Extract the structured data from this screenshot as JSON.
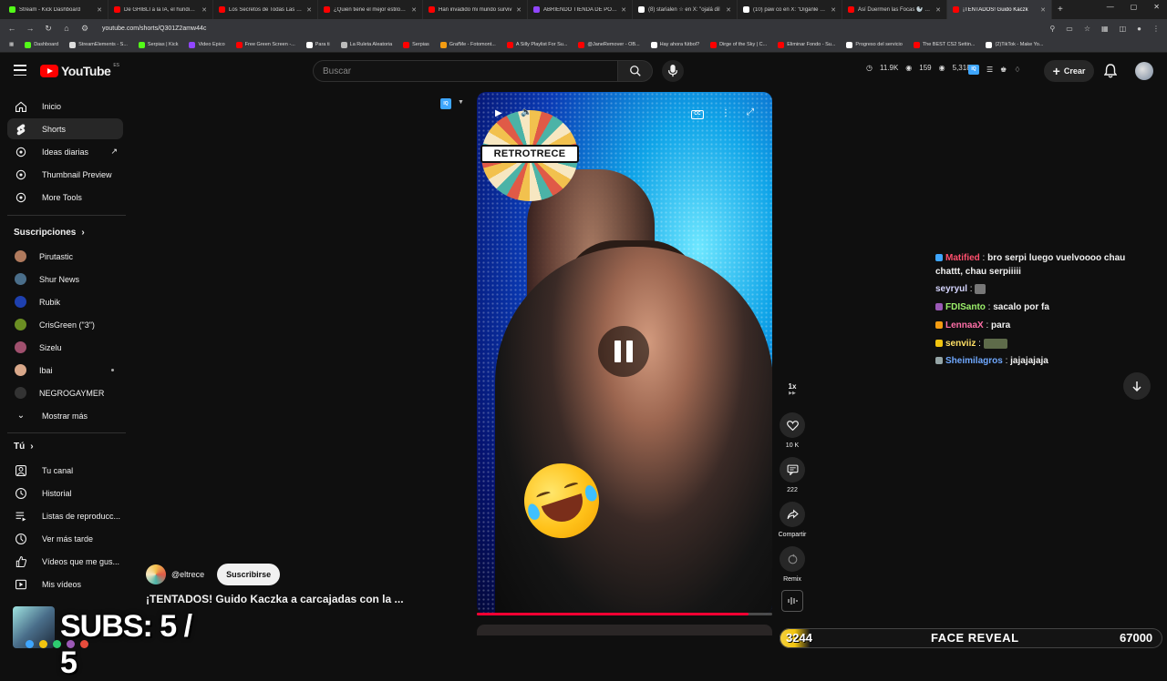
{
  "browser": {
    "tabs": [
      {
        "title": "Stream - Kick Dashboard",
        "color": "#53fc18"
      },
      {
        "title": "De GHIBLI a la IA, el hundimie",
        "color": "#ff0000"
      },
      {
        "title": "Los Secretos de Todas Las Esta",
        "color": "#ff0000"
      },
      {
        "title": "¿Quién tiene el mejor estilo? E",
        "color": "#ff0000"
      },
      {
        "title": "Han invadido mi mundo surviv",
        "color": "#ff0000"
      },
      {
        "title": "ABRIENDO TIENDA DE POKE",
        "color": "#9146ff"
      },
      {
        "title": "(8) starialen ☆ en X: \"ojalá dil",
        "color": "#ffffff"
      },
      {
        "title": "(10) paw co en X: \"Díganle a S",
        "color": "#ffffff"
      },
      {
        "title": "Así Duermen las Focas 🦭 #sh",
        "color": "#ff0000"
      },
      {
        "title": "¡TENTADOS! Guido Kaczk",
        "color": "#ff0000",
        "active": true
      }
    ],
    "url": "youtube.com/shorts/Q301Z2amw44c",
    "bookmarks": [
      {
        "label": "Dashboard",
        "color": "#53fc18"
      },
      {
        "label": "StreamElements - S...",
        "color": "#dddddd"
      },
      {
        "label": "Serpias | Kick",
        "color": "#53fc18"
      },
      {
        "label": "Video Epico",
        "color": "#9146ff"
      },
      {
        "label": "Free Green Screen -...",
        "color": "#ff0000"
      },
      {
        "label": "Para ti",
        "color": "#ffffff"
      },
      {
        "label": "La Ruleta Aleatoria",
        "color": "#bbbbbb"
      },
      {
        "label": "Serpias",
        "color": "#ff0000"
      },
      {
        "label": "GrafMe - Fotomont...",
        "color": "#f39c12"
      },
      {
        "label": "A Silly Playlist For Su...",
        "color": "#ff0000"
      },
      {
        "label": "@JaneRemover - OB...",
        "color": "#ff0000"
      },
      {
        "label": "Hay ahora fútbol?",
        "color": "#ffffff"
      },
      {
        "label": "Dirge of the Sky | C...",
        "color": "#ff0000"
      },
      {
        "label": "Eliminar Fondo - Su...",
        "color": "#ff0000"
      },
      {
        "label": "Progreso del servicio",
        "color": "#ffffff"
      },
      {
        "label": "The BEST CS2 Settin...",
        "color": "#ff0000"
      },
      {
        "label": "(2)TikTok - Make Yo...",
        "color": "#ffffff"
      }
    ]
  },
  "header": {
    "logo": "YouTube",
    "logo_country": "ES",
    "search_placeholder": "Buscar",
    "stats": {
      "views": "11.9K",
      "watching": "159",
      "eye2": "5,318"
    },
    "ext_label": "IQ",
    "create_label": "Crear"
  },
  "sidebar": {
    "main": [
      {
        "label": "Inicio",
        "icon": "home-icon"
      },
      {
        "label": "Shorts",
        "icon": "shorts-icon",
        "active": true
      },
      {
        "label": "Ideas diarias",
        "icon": "ideas-icon"
      },
      {
        "label": "Thumbnail Preview",
        "icon": "thumbnail-icon"
      },
      {
        "label": "More Tools",
        "icon": "tools-icon"
      }
    ],
    "subs_heading": "Suscripciones",
    "subscriptions": [
      {
        "label": "Pirutastic",
        "color": "#b07a5d"
      },
      {
        "label": "Shur News",
        "color": "#4a6e8a"
      },
      {
        "label": "Rubik",
        "color": "#1e40af"
      },
      {
        "label": "CrisGreen (\"3\")",
        "color": "#6b8e23"
      },
      {
        "label": "Sizelu",
        "color": "#a0506e"
      },
      {
        "label": "Ibai",
        "color": "#d9a88a",
        "new": true
      },
      {
        "label": "NEGROGAYMER",
        "color": "#333333"
      }
    ],
    "show_more": "Mostrar más",
    "you_heading": "Tú",
    "you": [
      {
        "label": "Tu canal",
        "icon": "channel-icon"
      },
      {
        "label": "Historial",
        "icon": "history-icon"
      },
      {
        "label": "Listas de reproducc...",
        "icon": "playlists-icon"
      },
      {
        "label": "Ver más tarde",
        "icon": "watch-later-icon"
      },
      {
        "label": "Vídeos que me gus...",
        "icon": "like-icon"
      },
      {
        "label": "Mis vídeos",
        "icon": "my-videos-icon"
      }
    ]
  },
  "player": {
    "overlay_logo": "RETROTRECE",
    "cc": "CC",
    "progress": 0.92
  },
  "actions": {
    "speed": "1x",
    "likes": "10 K",
    "comments": "222",
    "share": "Compartir",
    "remix": "Remix"
  },
  "channel": {
    "handle": "@eltrece",
    "subscribe": "Suscribirse",
    "title": "¡TENTADOS! Guido Kaczka a carcajadas con la ..."
  },
  "chat": [
    {
      "user": "Matified",
      "msg": "bro serpi luego vuelvoooo chau",
      "cont": "chattt, chau serpiiiii",
      "color": "#ff4f6d",
      "badge": "#3ea6ff"
    },
    {
      "user": "seyryul",
      "msg": "",
      "color": "#d6d6ff",
      "emote": "small"
    },
    {
      "user": "FDISanto",
      "msg": "sacalo por fa",
      "color": "#9cf06b",
      "badge": "#9b59b6"
    },
    {
      "user": "LennaaX",
      "msg": "para",
      "color": "#ff6fa8",
      "badge": "#f39c12"
    },
    {
      "user": "senviiz",
      "msg": "",
      "color": "#ffe066",
      "badge": "#f1c40f",
      "emote": "wide"
    },
    {
      "user": "Sheimilagros",
      "msg": "jajajajaja",
      "color": "#6fa8ff",
      "badge": "#95a5a6"
    }
  ],
  "stream_overlay": {
    "subs": "SUBS: 5 / 5",
    "goal_current": "3244",
    "goal_label": "FACE REVEAL",
    "goal_target": "67000"
  }
}
